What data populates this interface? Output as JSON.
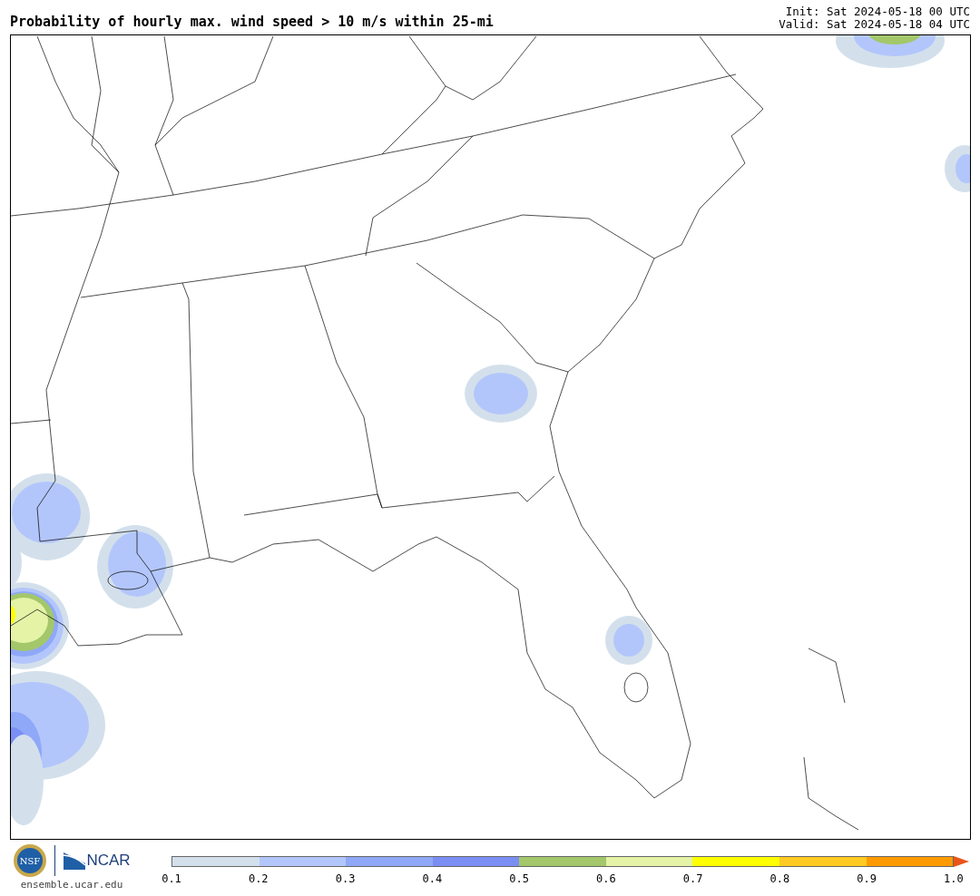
{
  "header": {
    "title": "Probability of hourly max. wind speed > 10 m/s within 25-mi",
    "init": "Init: Sat 2024-05-18 00 UTC",
    "valid": "Valid: Sat 2024-05-18 04 UTC"
  },
  "logos": {
    "nsf": "NSF",
    "ncar": "NCAR",
    "site": "ensemble.ucar.edu"
  },
  "colorbar": {
    "segments": [
      {
        "kind": "band",
        "color": "#d3e0ec"
      },
      {
        "kind": "band",
        "color": "#b3c6fb"
      },
      {
        "kind": "band",
        "color": "#8fa8f7"
      },
      {
        "kind": "band",
        "color": "#7a8ef4"
      },
      {
        "kind": "band",
        "color": "#a3c76a"
      },
      {
        "kind": "band",
        "color": "#e4f3a6"
      },
      {
        "kind": "band",
        "color": "#ffff00"
      },
      {
        "kind": "band",
        "color": "#ffcb22"
      },
      {
        "kind": "band",
        "color": "#ff9b00"
      },
      {
        "kind": "arrow",
        "color": "#e8551a"
      }
    ],
    "ticks": [
      "0.1",
      "0.2",
      "0.3",
      "0.4",
      "0.5",
      "0.6",
      "0.7",
      "0.8",
      "0.9",
      "1.0"
    ]
  }
}
